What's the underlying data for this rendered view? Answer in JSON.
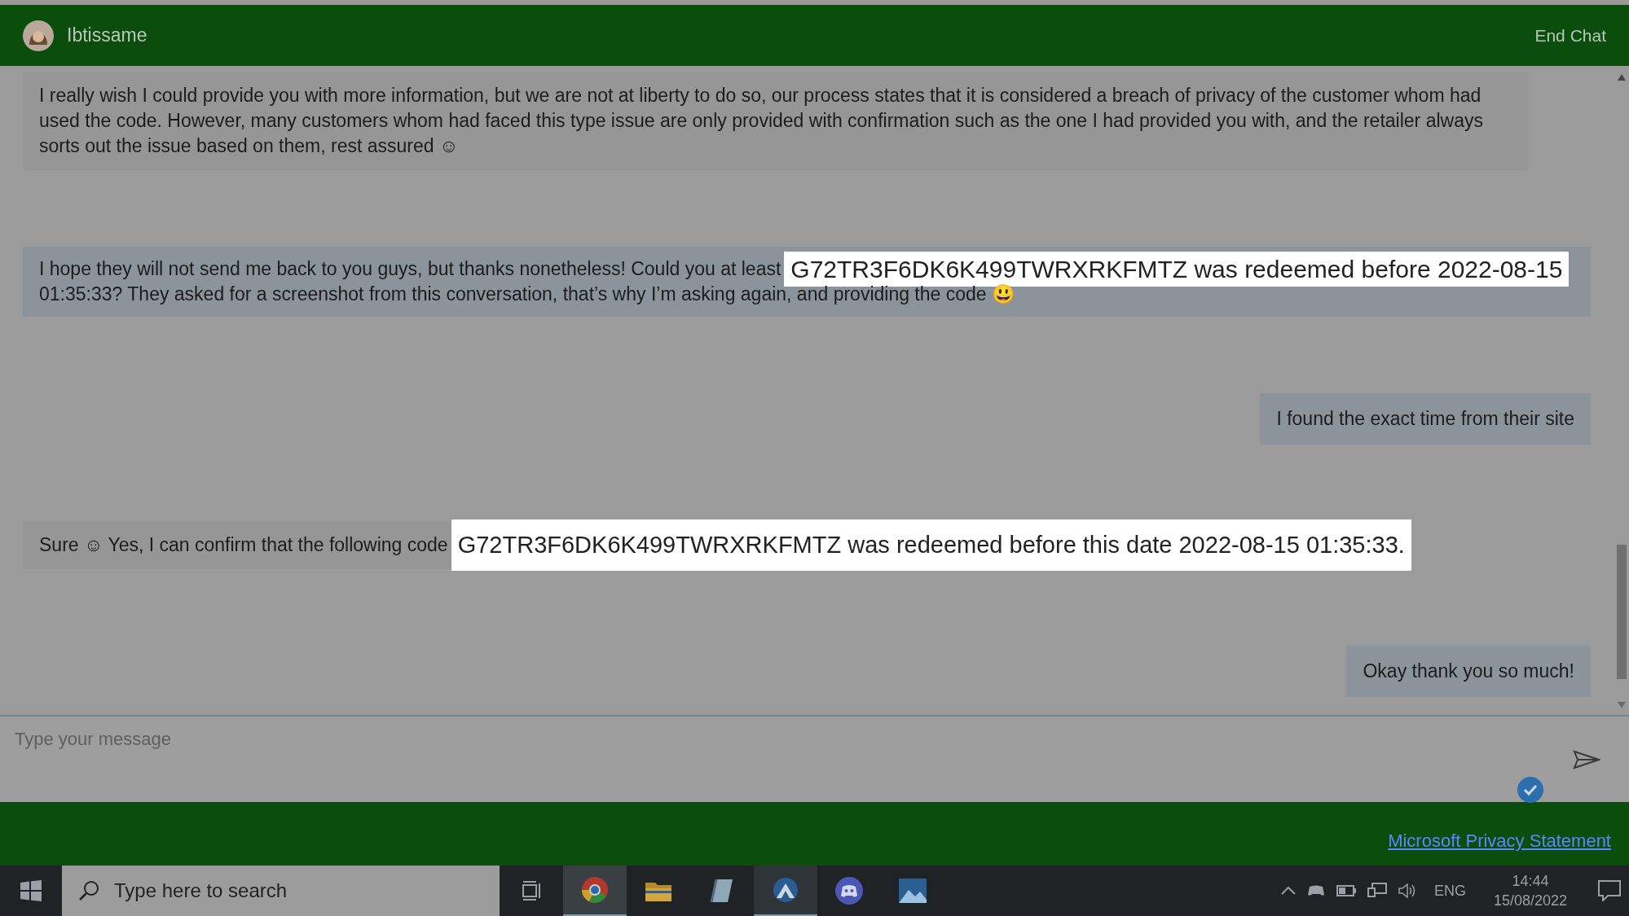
{
  "header": {
    "agent_name": "Ibtissame",
    "end_button": "End Chat"
  },
  "messages": [
    {
      "kind": "agent",
      "lines": [
        "I really wish I could provide you with more information, but we are not at liberty to do so, our process states that it is considered a breach of privacy of the customer whom had used the code. However, many customers whom had faced this type issue are only provided with confirmation such as the one I had provided you with, and the retailer always sorts out the issue based on them, rest assured ☺"
      ]
    },
    {
      "kind": "user_wide",
      "lines": [
        "I hope they will not send me back to you guys, but thanks nonetheless! Could you at least",
        "01:35:33? They asked for a screenshot from this conversation, that’s why I’m asking again, and providing the code 😃"
      ],
      "overlay": "G72TR3F6DK6K499TWRXRKFMTZ was redeemed before 2022-08-15"
    },
    {
      "kind": "user",
      "lines": [
        "I found the exact time from their site"
      ]
    },
    {
      "kind": "agent",
      "lines": [
        "Sure ☺ Yes, I can confirm that the following code"
      ],
      "overlay": "G72TR3F6DK6K499TWRXRKFMTZ was redeemed before this date 2022-08-15 01:35:33."
    },
    {
      "kind": "user",
      "lines": [
        "Okay thank you so much!"
      ]
    }
  ],
  "composer": {
    "placeholder": "Type your message"
  },
  "footer": {
    "link": "Microsoft Privacy Statement"
  },
  "taskbar": {
    "search_placeholder": "Type here to search",
    "language": "ENG",
    "time": "14:44",
    "date": "15/08/2022"
  }
}
